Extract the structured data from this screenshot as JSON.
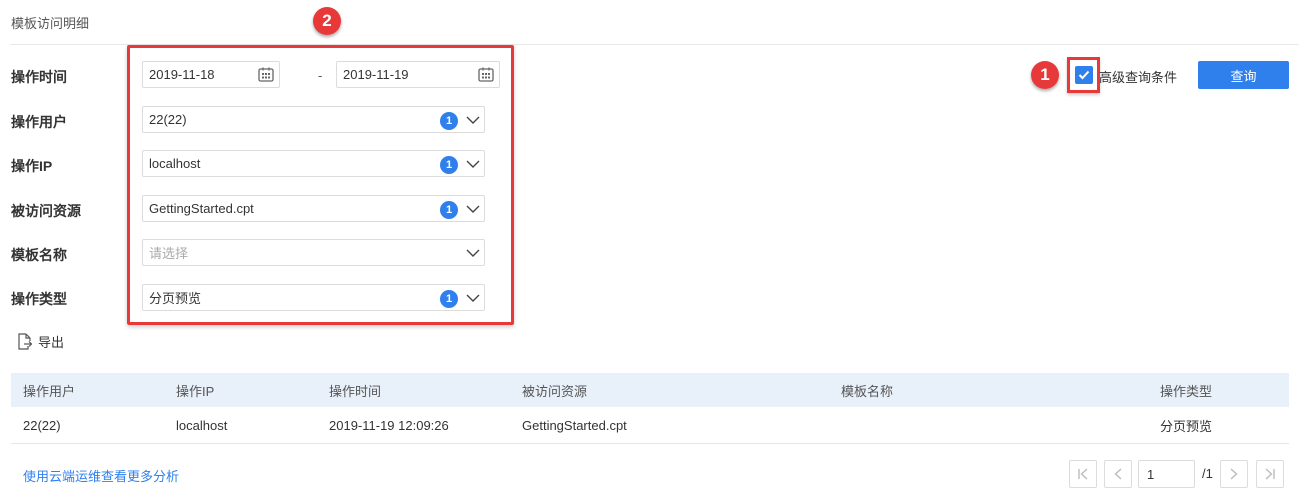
{
  "page": {
    "title": "模板访问明细"
  },
  "annotations": {
    "marker_1": "1",
    "marker_2": "2"
  },
  "filters": {
    "time": {
      "label": "操作时间",
      "start": "2019-11-18",
      "end": "2019-11-19",
      "separator": "-"
    },
    "user": {
      "label": "操作用户",
      "value": "22(22)",
      "count": "1"
    },
    "ip": {
      "label": "操作IP",
      "value": "localhost",
      "count": "1"
    },
    "resource": {
      "label": "被访问资源",
      "value": "GettingStarted.cpt",
      "count": "1"
    },
    "template_name": {
      "label": "模板名称",
      "placeholder": "请选择"
    },
    "op_type": {
      "label": "操作类型",
      "value": "分页预览",
      "count": "1"
    }
  },
  "advanced": {
    "label": "高级查询条件",
    "checked": true
  },
  "query_button": {
    "label": "查询"
  },
  "export": {
    "label": "导出"
  },
  "table": {
    "columns": [
      "操作用户",
      "操作IP",
      "操作时间",
      "被访问资源",
      "模板名称",
      "操作类型"
    ],
    "rows": [
      [
        "22(22)",
        "localhost",
        "2019-11-19 12:09:26",
        "GettingStarted.cpt",
        "",
        "分页预览"
      ]
    ]
  },
  "footer": {
    "link": "使用云端运维查看更多分析"
  },
  "pagination": {
    "current": "1",
    "total": "/1"
  },
  "colors": {
    "accent": "#2f80ed",
    "annotation": "#e8393a",
    "header_bg": "#e8f0fa"
  }
}
